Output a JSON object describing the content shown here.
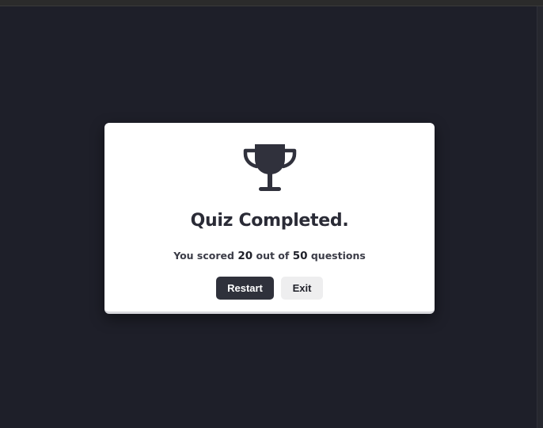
{
  "modal": {
    "icon": "trophy-icon",
    "title": "Quiz Completed.",
    "score": {
      "prefix": "You scored",
      "correct": "20",
      "middle": "out of",
      "total": "50",
      "suffix": "questions"
    },
    "buttons": {
      "restart_label": "Restart",
      "exit_label": "Exit"
    }
  },
  "colors": {
    "background": "#1e1f29",
    "modal_background": "#ffffff",
    "primary_button": "#2f313b",
    "secondary_button": "#eeeeef",
    "text_dark": "#2a2b36"
  }
}
